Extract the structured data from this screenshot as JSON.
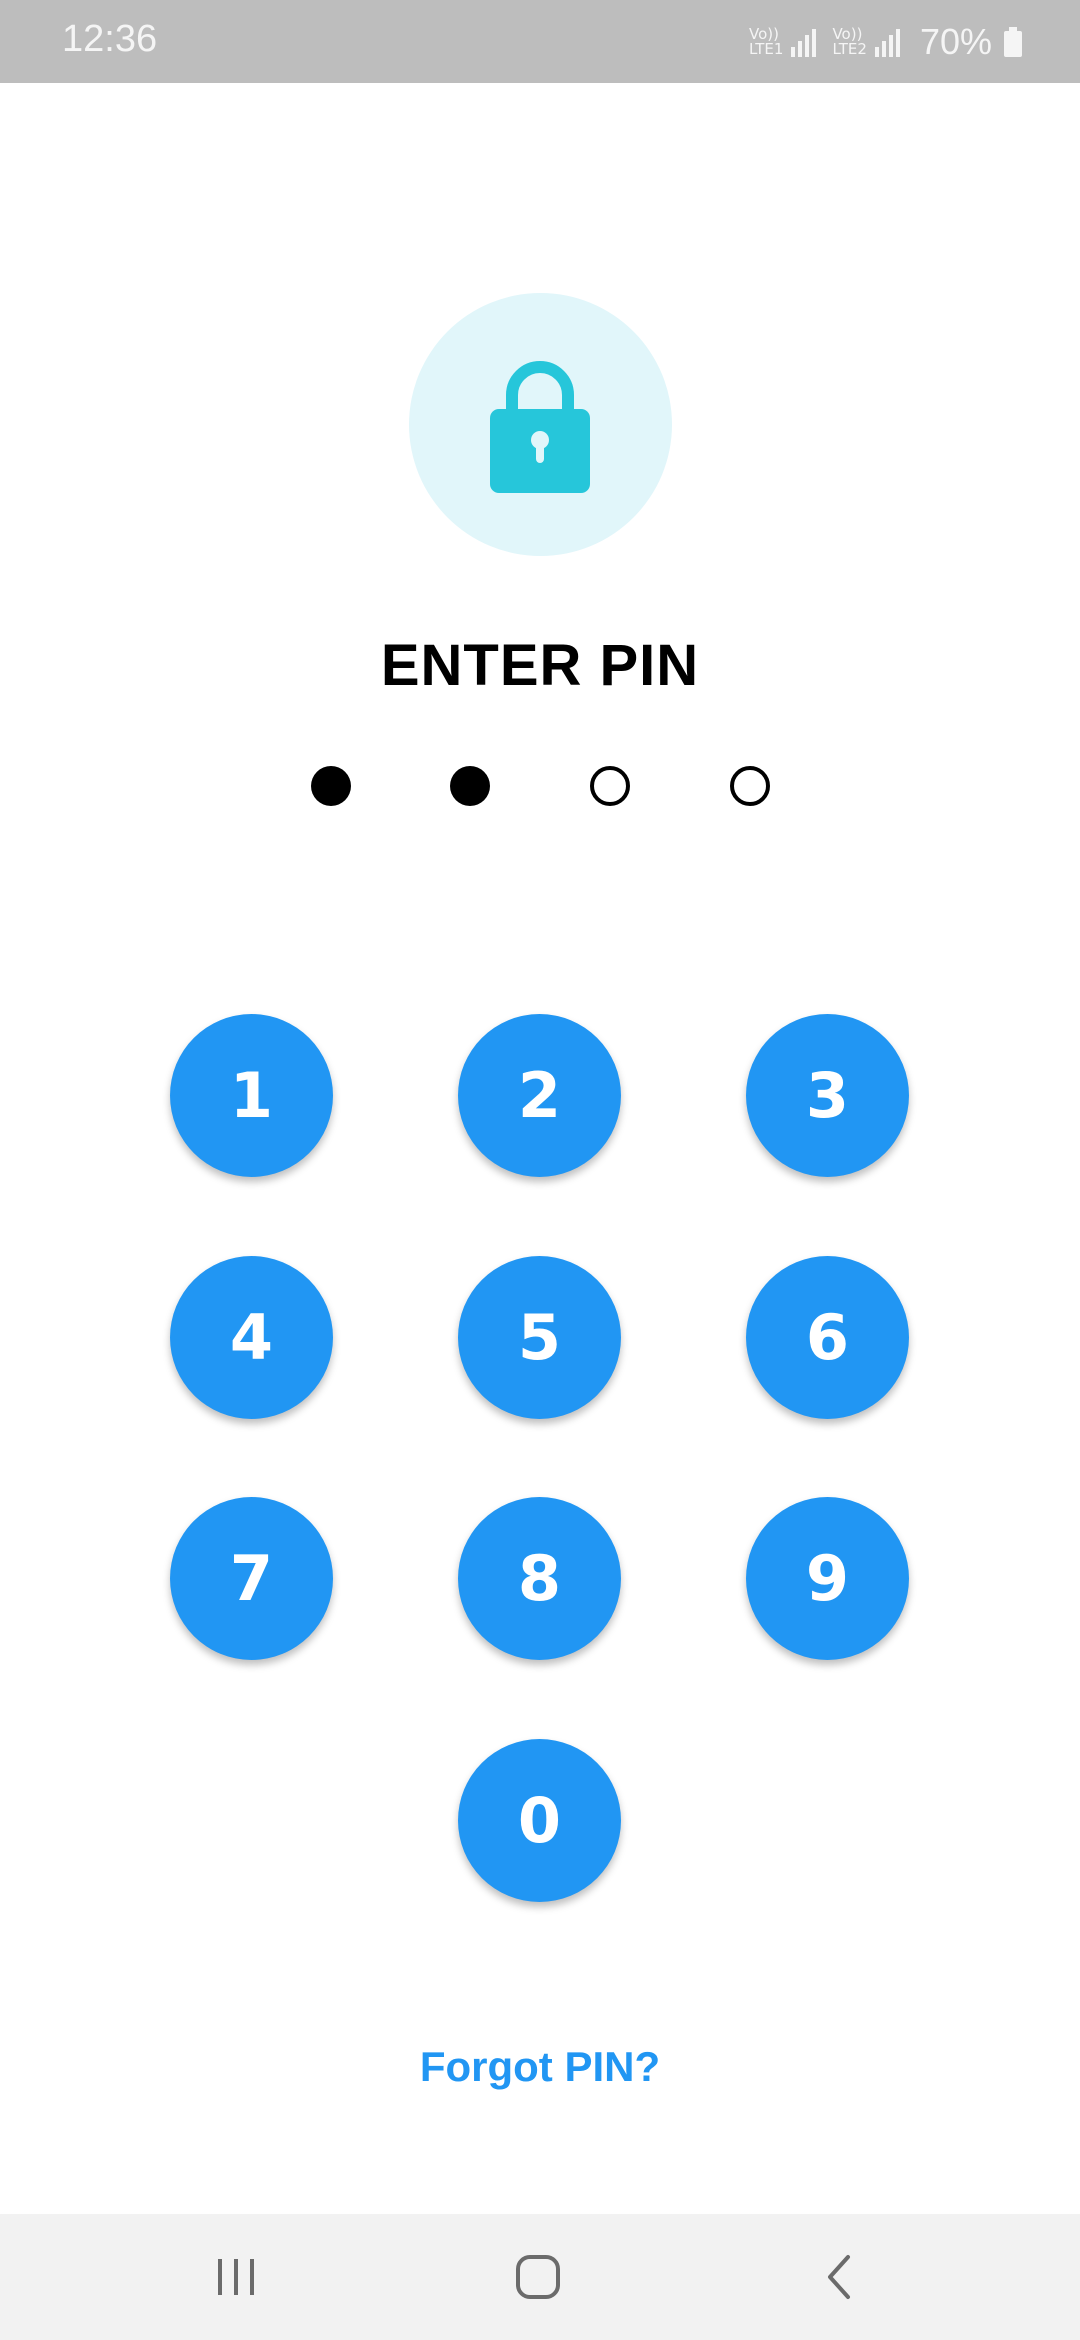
{
  "status_bar": {
    "time": "12:36",
    "sim1": {
      "top": "Vo))",
      "bottom": "LTE1"
    },
    "sim2": {
      "top": "Vo))",
      "bottom": "LTE2"
    },
    "battery": "70%",
    "icons": [
      "signal-icon",
      "battery-icon"
    ]
  },
  "lock_icon": "lock-icon",
  "title": "ENTER PIN",
  "pin": {
    "length": 4,
    "entered": 2
  },
  "keypad": {
    "keys": [
      "1",
      "2",
      "3",
      "4",
      "5",
      "6",
      "7",
      "8",
      "9",
      "0"
    ]
  },
  "forgot_link": "Forgot PIN?",
  "nav_bar": {
    "icons": [
      "recent-apps-icon",
      "home-icon",
      "back-icon"
    ]
  },
  "colors": {
    "accent": "#2196f3",
    "lock": "#26c6da",
    "lock_bg": "#e1f6fa",
    "status_bar": "#bdbdbd",
    "nav_bar": "#f2f2f2"
  }
}
